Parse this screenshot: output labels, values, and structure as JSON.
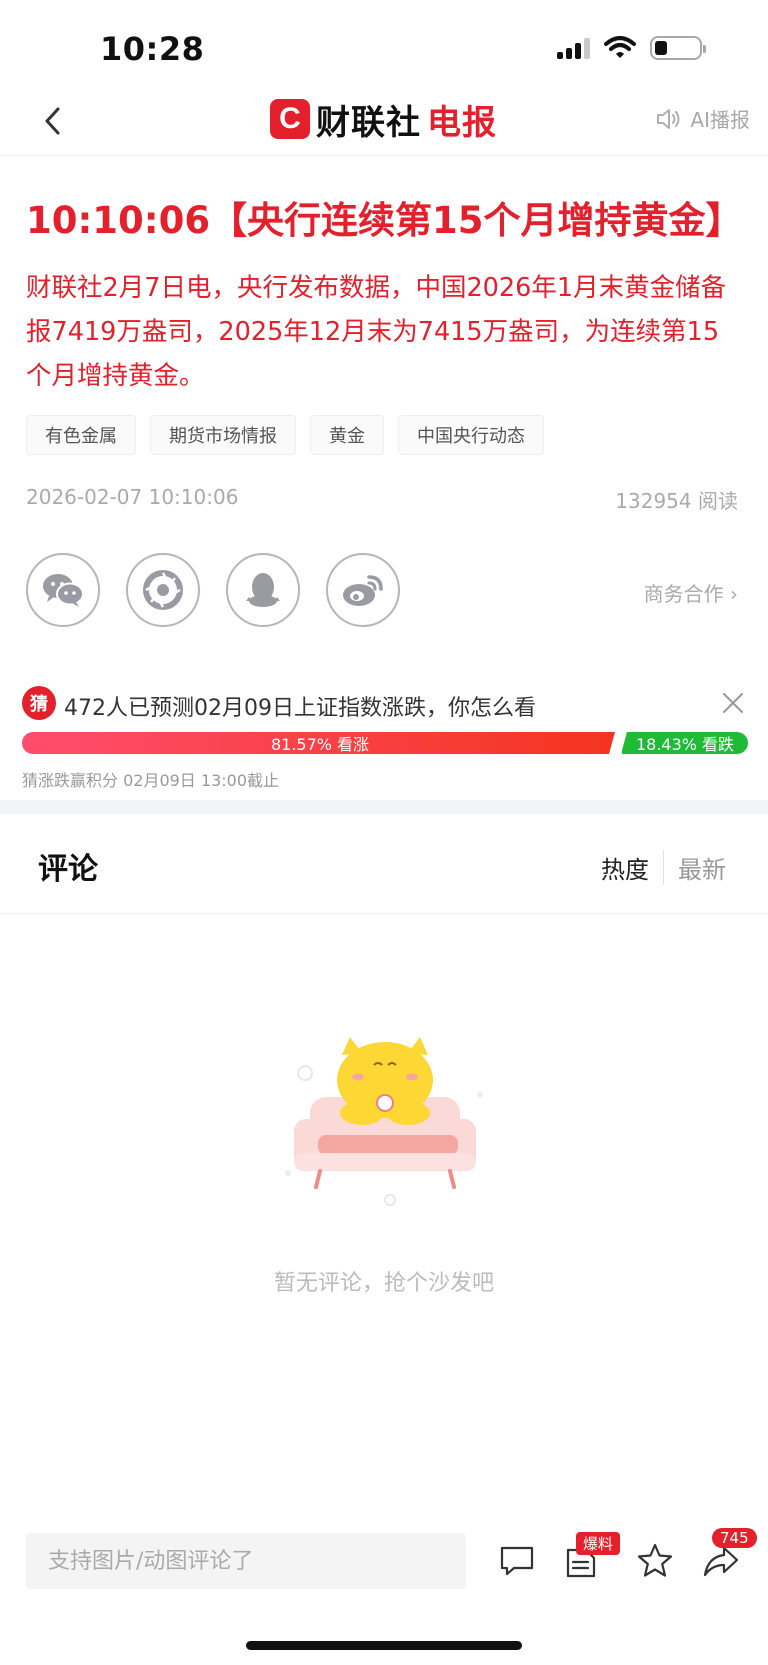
{
  "status_bar": {
    "time": "10:28"
  },
  "nav": {
    "brand_logo": "C",
    "brand_name": "财联社",
    "brand_name_red": "电报",
    "ai_play_label": "AI播报"
  },
  "article": {
    "title": "10:10:06【央行连续第15个月增持黄金】",
    "body": "财联社2月7日电，央行发布数据，中国2026年1月末黄金储备报7419万盎司，2025年12月末为7415万盎司，为连续第15个月增持黄金。",
    "tags": [
      "有色金属",
      "期货市场情报",
      "黄金",
      "中国央行动态"
    ],
    "datetime": "2026-02-07 10:10:06",
    "reads": "132954 阅读"
  },
  "share": {
    "icons": [
      "wechat-icon",
      "moments-icon",
      "qq-icon",
      "weibo-icon"
    ],
    "business_label": "商务合作 ›"
  },
  "prediction": {
    "badge": "猜",
    "question": "472人已预测02月09日上证指数涨跌，你怎么看",
    "up_percent": 81.57,
    "up_label": "81.57% 看涨",
    "down_percent": 18.43,
    "down_label": "18.43% 看跌",
    "note": "猜涨跌赢积分   02月09日 13:00截止"
  },
  "comments": {
    "title": "评论",
    "sort_hot": "热度",
    "sort_new": "最新",
    "empty_text": "暂无评论，抢个沙发吧"
  },
  "bottom_bar": {
    "input_placeholder": "支持图片/动图评论了",
    "tip_badge": "爆料",
    "share_count": "745"
  },
  "colors": {
    "accent_red": "#e3202b",
    "up_red": "#f4341f",
    "down_green": "#1fbb37"
  }
}
